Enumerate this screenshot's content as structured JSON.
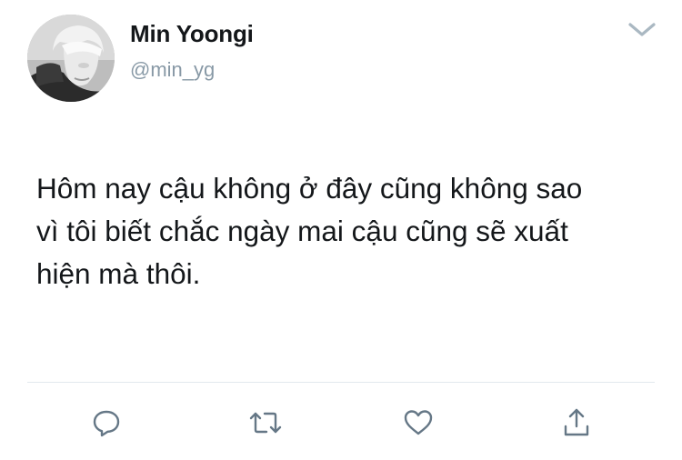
{
  "tweet": {
    "author": {
      "display_name": "Min Yoongi",
      "handle": "@min_yg",
      "avatar_icon": "profile-photo"
    },
    "menu_icon": "chevron-down-icon",
    "text_lines": [
      "Hôm nay cậu không ở đây cũng không sao",
      "vì tôi biết chắc ngày mai cậu cũng sẽ xuất",
      "hiện mà thôi."
    ],
    "actions": {
      "reply_icon": "reply-icon",
      "retweet_icon": "retweet-icon",
      "like_icon": "heart-icon",
      "share_icon": "share-icon"
    }
  },
  "colors": {
    "name": "#14171a",
    "handle": "#8899a6",
    "icon": "#657786",
    "divider": "#e1e8ed"
  }
}
